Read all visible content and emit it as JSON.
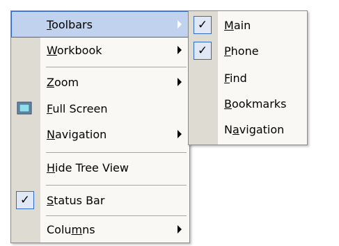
{
  "main_menu": {
    "items": [
      {
        "pre": "",
        "accel": "T",
        "post": "oolbars"
      },
      {
        "pre": "",
        "accel": "W",
        "post": "orkbook"
      },
      {
        "pre": "",
        "accel": "Z",
        "post": "oom"
      },
      {
        "pre": "",
        "accel": "F",
        "post": "ull Screen"
      },
      {
        "pre": "",
        "accel": "N",
        "post": "avigation"
      },
      {
        "pre": "",
        "accel": "H",
        "post": "ide Tree View"
      },
      {
        "pre": "",
        "accel": "S",
        "post": "tatus Bar"
      },
      {
        "pre": "Colu",
        "accel": "m",
        "post": "ns"
      }
    ],
    "check_glyph": "✓"
  },
  "toolbars_submenu": {
    "items": [
      {
        "pre": "",
        "accel": "M",
        "post": "ain",
        "checked": true
      },
      {
        "pre": "",
        "accel": "P",
        "post": "hone",
        "checked": true
      },
      {
        "pre": "",
        "accel": "F",
        "post": "ind",
        "checked": false
      },
      {
        "pre": "",
        "accel": "B",
        "post": "ookmarks",
        "checked": false
      },
      {
        "pre": "N",
        "accel": "a",
        "post": "vigation",
        "checked": false
      }
    ]
  },
  "colors": {
    "highlight": "#c1d2ee",
    "highlight_border": "#316ac5",
    "gutter": "#dedbd2",
    "menu_bg": "#f9f8f4"
  }
}
